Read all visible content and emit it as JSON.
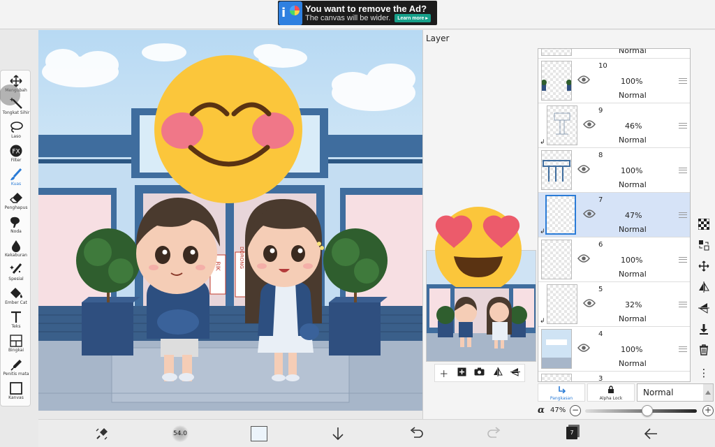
{
  "ad": {
    "title": "You want to remove the Ad?",
    "subtitle": "The canvas will be wider.",
    "button": "Learn more ▸"
  },
  "tools": [
    {
      "name": "transform",
      "label": "Mengubah",
      "icon": "move-arrows-icon"
    },
    {
      "name": "magic-wand",
      "label": "Tongkat Sihir",
      "icon": "magic-wand-icon"
    },
    {
      "name": "lasso",
      "label": "Laso",
      "icon": "lasso-icon"
    },
    {
      "name": "filter",
      "label": "Filter",
      "icon": "fx-icon"
    },
    {
      "name": "brush",
      "label": "Kuas",
      "icon": "brush-icon",
      "active": true
    },
    {
      "name": "eraser",
      "label": "Penghapus",
      "icon": "eraser-icon"
    },
    {
      "name": "smudge",
      "label": "Noda",
      "icon": "smudge-icon"
    },
    {
      "name": "blur",
      "label": "Kekaburan",
      "icon": "drop-icon"
    },
    {
      "name": "special",
      "label": "Spesial",
      "icon": "sparkle-brush-icon"
    },
    {
      "name": "fill",
      "label": "Ember Cat",
      "icon": "paint-bucket-icon"
    },
    {
      "name": "text",
      "label": "Teks",
      "icon": "text-icon"
    },
    {
      "name": "frame",
      "label": "Bingkai",
      "icon": "frame-icon"
    },
    {
      "name": "eyedropper",
      "label": "Penitis mata",
      "icon": "eyedropper-icon"
    },
    {
      "name": "canvas",
      "label": "Kanvas",
      "icon": "canvas-icon"
    }
  ],
  "canvas": {
    "sign_left": "RIK",
    "sign_right": "DORONG"
  },
  "panel": {
    "title": "Layer",
    "layers": [
      {
        "num": "",
        "opacity": "",
        "mode": "Normal",
        "partial": true
      },
      {
        "num": "10",
        "opacity": "100%",
        "mode": "Normal"
      },
      {
        "num": "9",
        "opacity": "46%",
        "mode": "Normal",
        "clip": true
      },
      {
        "num": "8",
        "opacity": "100%",
        "mode": "Normal"
      },
      {
        "num": "7",
        "opacity": "47%",
        "mode": "Normal",
        "clip": true,
        "selected": true
      },
      {
        "num": "6",
        "opacity": "100%",
        "mode": "Normal"
      },
      {
        "num": "5",
        "opacity": "32%",
        "mode": "Normal",
        "clip": true
      },
      {
        "num": "4",
        "opacity": "100%",
        "mode": "Normal"
      },
      {
        "num": "3",
        "opacity": "",
        "mode": "",
        "partial": true
      }
    ],
    "clipping_label": "Pangkasan",
    "alpha_lock_label": "Alpha Lock",
    "blend_mode": "Normal",
    "alpha_symbol": "α",
    "alpha_value": "47%",
    "alpha_fraction": 0.47
  },
  "bottom": {
    "brush_size": "54.0",
    "layer_count": "7"
  }
}
